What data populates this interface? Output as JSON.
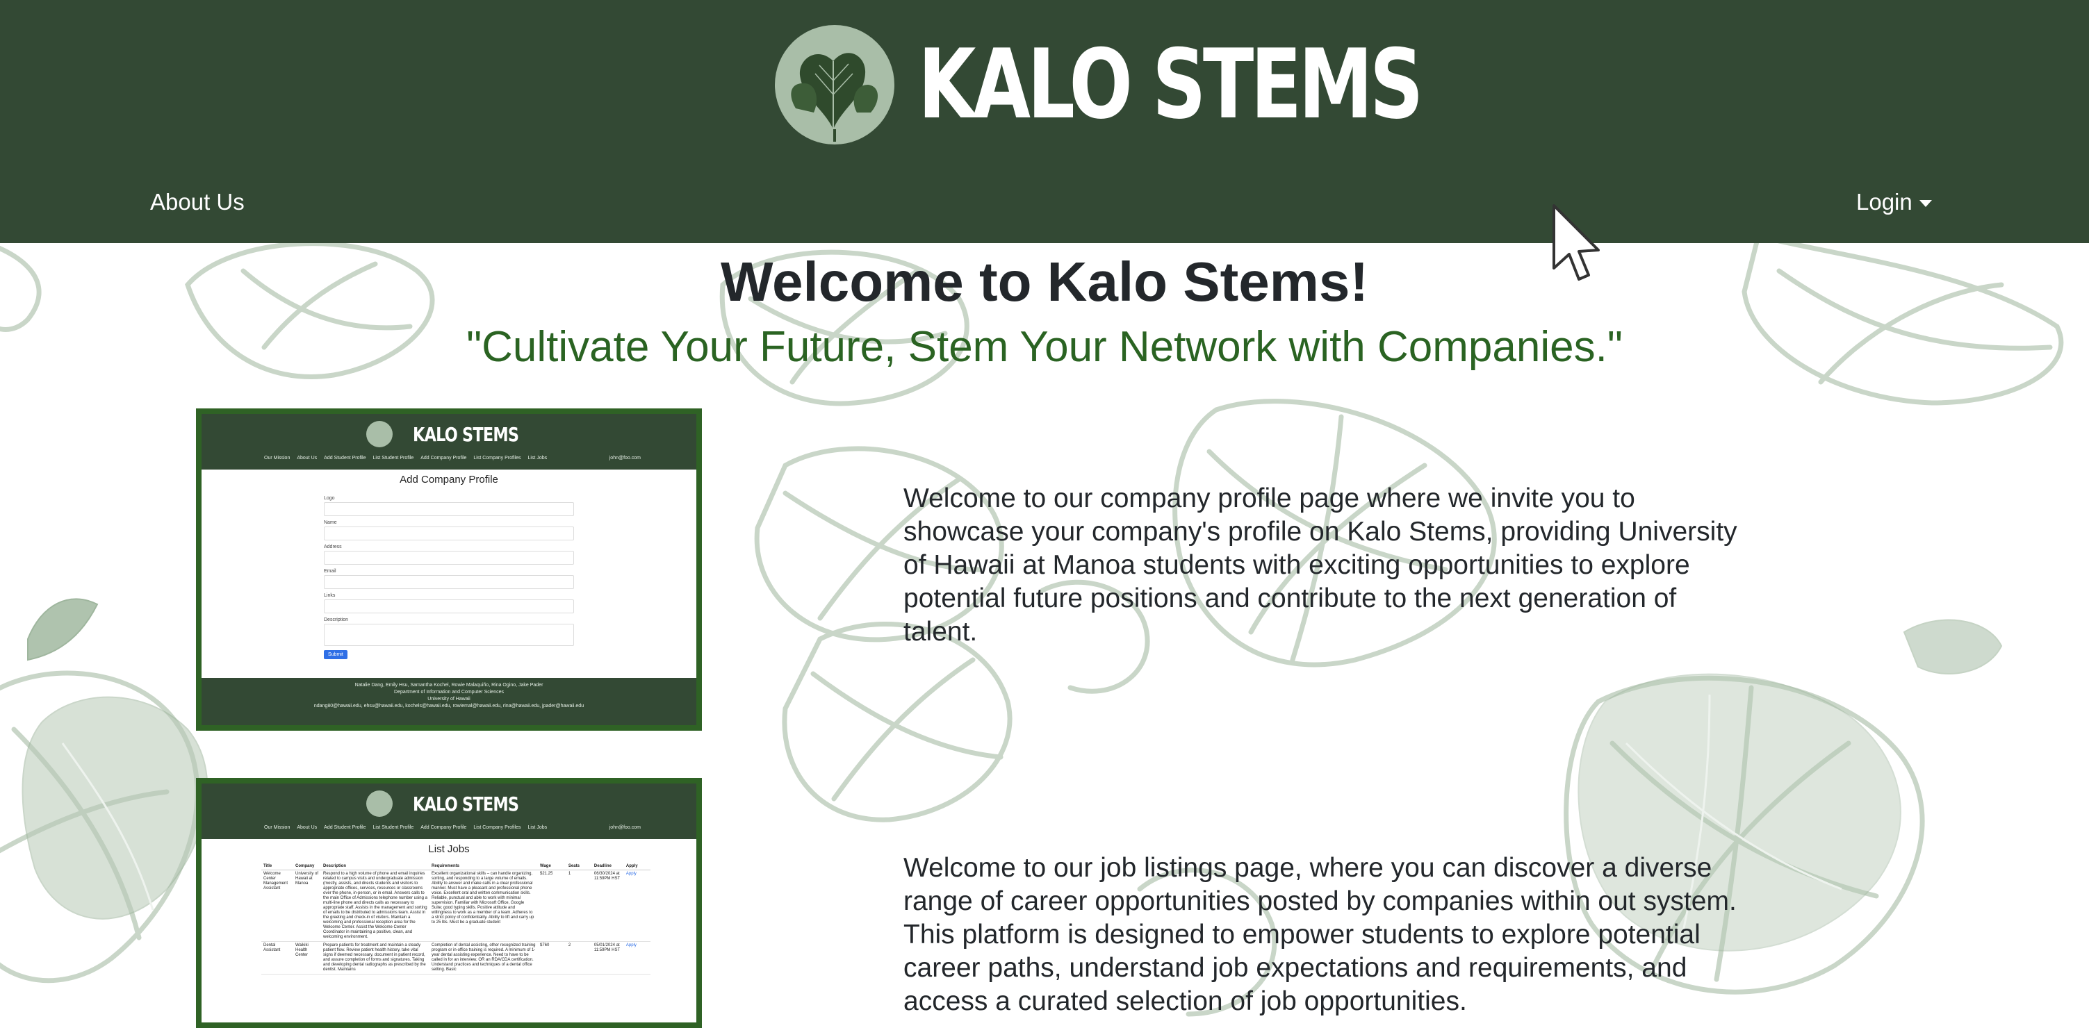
{
  "header": {
    "brand_title": "KALO STEMS",
    "logo_icon": "taro-leaf-logo-icon",
    "background_color": "#334934",
    "nav": {
      "about_label": "About Us",
      "login_label": "Login"
    }
  },
  "main": {
    "title": "Welcome to Kalo Stems!",
    "tagline": "\"Cultivate Your Future, Stem Your Network with Companies.\"",
    "sections": [
      {
        "description": "Welcome to our company profile page where we invite you to showcase your company's profile on Kalo Stems, providing University of Hawaii at Manoa students with exciting opportunities to explore potential future positions and contribute to the next generation of talent."
      },
      {
        "description": "Welcome to our job listings page, where you can discover a diverse range of career opportunities posted by companies within out system. This platform is designed to empower students to explore potential career paths, understand job expectations and requirements, and access a curated selection of job opportunities."
      }
    ]
  },
  "preview_add_company": {
    "brand": "KALO STEMS",
    "nav": [
      "Our Mission",
      "About Us",
      "Add Student Profile",
      "List Student Profile",
      "Add Company Profile",
      "List Company Profiles",
      "List Jobs"
    ],
    "user": "john@foo.com",
    "page_title": "Add Company Profile",
    "fields": [
      "Logo",
      "Name",
      "Address",
      "Email",
      "Links",
      "Description"
    ],
    "submit_label": "Submit",
    "footer_lines": [
      "Natalie Dang, Emily Hsu, Samantha Kochel, Rowie Malaquiño, Rina Ogino, Jake Pader",
      "Department of Information and Computer Sciences",
      "University of Hawaii",
      "ndang80@hawaii.edu, ehsu@hawaii.edu, kochels@hawaii.edu, rowiemal@hawaii.edu, rina@hawaii.edu, jpader@hawaii.edu"
    ]
  },
  "preview_list_jobs": {
    "brand": "KALO STEMS",
    "nav": [
      "Our Mission",
      "About Us",
      "Add Student Profile",
      "List Student Profile",
      "Add Company Profile",
      "List Company Profiles",
      "List Jobs"
    ],
    "user": "john@foo.com",
    "page_title": "List Jobs",
    "columns": [
      "Title",
      "Company",
      "Description",
      "Requirements",
      "Wage",
      "Seats",
      "Deadline",
      "Apply"
    ],
    "rows": [
      {
        "title": "Welcome Center Management Assistant",
        "company": "University of Hawaii at Manoa",
        "description": "Respond to a high volume of phone and email inquiries related to campus visits and undergraduate admission (mostly, assists, and directs students and visitors to appropriate offices, services, resources or classrooms over the phone, in-person, or in email. Answers calls to the main Office of Admissions telephone number using a multi-line phone and directs calls as necessary to appropriate staff. Assists in the management and sorting of emails to be distributed to admissions team. Assist in the greeting and check-in of visitors. Maintain a welcoming and professional reception area for the Welcome Center. Assist the Welcome Center Coordinator in maintaining a positive, clean, and welcoming environment.",
        "requirements": "Excellent organizational skills – can handle organizing, sorting, and responding to a large volume of emails. Ability to answer and make calls in a clear professional manner. Must have a pleasant and professional phone voice. Excellent oral and written communication skills. Reliable, punctual and able to work with minimal supervision. Familiar with Microsoft Office, Google Suite; good typing skills. Positive attitude and willingness to work as a member of a team. Adheres to a strict policy of confidentiality. Ability to lift and carry up to 25 lbs. Must be a graduate student",
        "wage": "$21.25",
        "seats": "1",
        "deadline": "06/30/2024 at 11:59PM HST",
        "apply": "Apply"
      },
      {
        "title": "Dental Assistant",
        "company": "Waikiki Health Center",
        "description": "Prepare patients for treatment and maintain a steady patient flow. Review patient health history, take vital signs if deemed necessary, document in patient record, and assure completion of forms and signatures. Taking and developing dental radiographs as prescribed by the dentist. Maintains",
        "requirements": "Completion of dental assisting, other recognized training program or in-office training is required. A minimum of 1-year dental assisting experience. Need to have to be called in for an interview. OR an RDA/CDA certification. Understand practices and techniques of a dental office setting. Basic",
        "wage": "$760",
        "seats": "2",
        "deadline": "05/01/2024 at 11:59PM HST",
        "apply": "Apply"
      }
    ]
  }
}
